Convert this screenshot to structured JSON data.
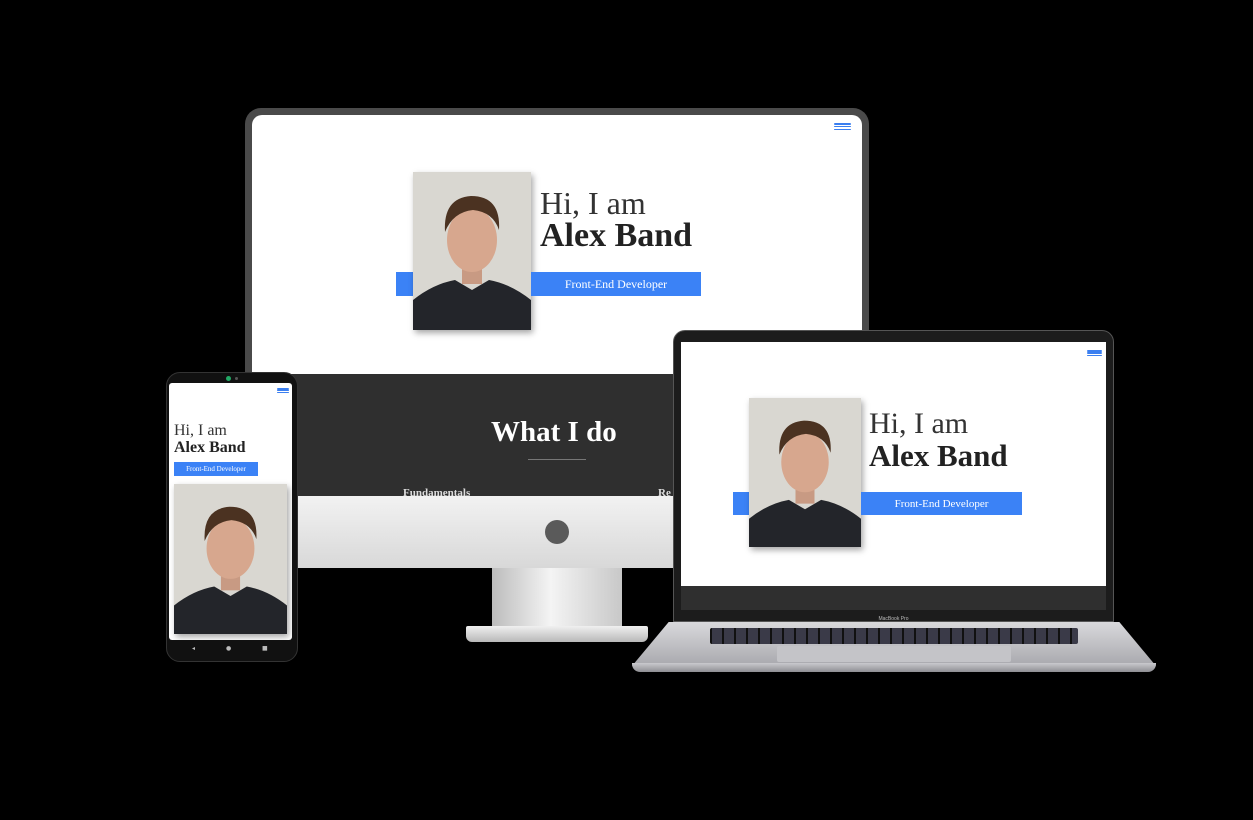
{
  "devices": {
    "monitor": {
      "hero": {
        "greeting": "Hi, I am",
        "name": "Alex Band",
        "role": "Front-End Developer"
      },
      "section": {
        "title": "What I do",
        "col_left": "Fundamentals",
        "col_right": "Re"
      }
    },
    "laptop": {
      "hero": {
        "greeting": "Hi, I am",
        "name": "Alex Band",
        "role": "Front-End Developer"
      },
      "brand_label": "MacBook Pro"
    },
    "phone": {
      "hero": {
        "greeting": "Hi, I am",
        "name": "Alex Band",
        "role": "Front-End Developer"
      },
      "nav": {
        "back": "◂",
        "home": "●",
        "recent": "■"
      }
    }
  },
  "colors": {
    "accent": "#3b82f6",
    "dark_section": "#2f2f2f",
    "background": "#000000"
  },
  "icons": {
    "menu": "hamburger-menu-icon"
  }
}
